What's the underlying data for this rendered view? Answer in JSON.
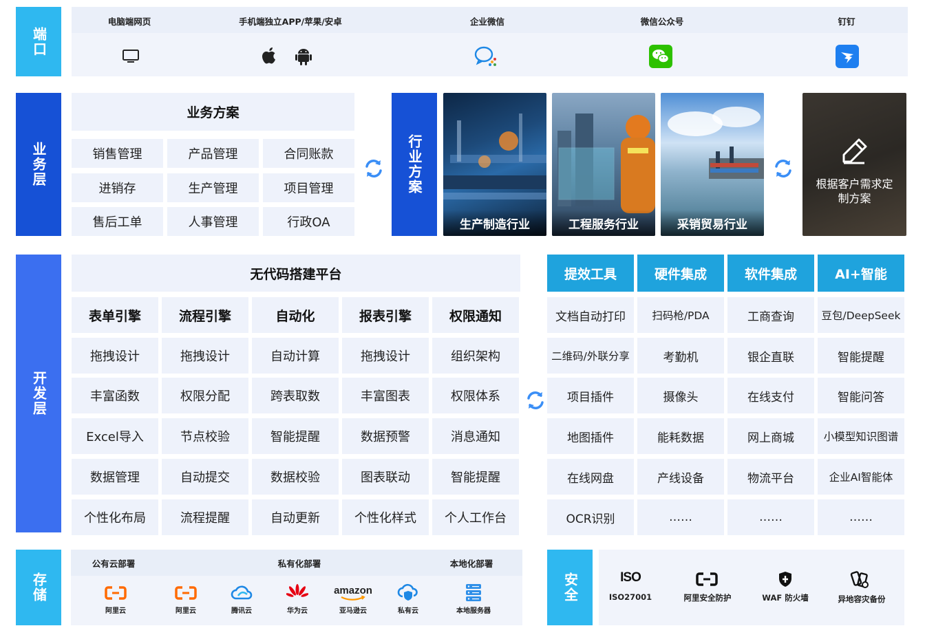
{
  "ports": {
    "side_label": "端口",
    "items": [
      {
        "label": "电脑端网页"
      },
      {
        "label": "手机端独立APP/苹果/安卓"
      },
      {
        "label": "企业微信"
      },
      {
        "label": "微信公众号"
      },
      {
        "label": "钉钉"
      }
    ]
  },
  "business": {
    "side_label": "业务层",
    "title": "业务方案",
    "items": [
      "销售管理",
      "产品管理",
      "合同账款",
      "进销存",
      "生产管理",
      "项目管理",
      "售后工单",
      "人事管理",
      "行政OA"
    ]
  },
  "industry": {
    "side_label": "行业方案",
    "photos": [
      "生产制造行业",
      "工程服务行业",
      "采销贸易行业"
    ],
    "custom": "根据客户需求定制方案"
  },
  "dev": {
    "side_label": "开发层",
    "title": "无代码搭建平台",
    "columns": [
      {
        "head": "表单引擎",
        "items": [
          "拖拽设计",
          "丰富函数",
          "Excel导入",
          "数据管理",
          "个性化布局"
        ]
      },
      {
        "head": "流程引擎",
        "items": [
          "拖拽设计",
          "权限分配",
          "节点校验",
          "自动提交",
          "流程提醒"
        ]
      },
      {
        "head": "自动化",
        "items": [
          "自动计算",
          "跨表取数",
          "智能提醒",
          "数据校验",
          "自动更新"
        ]
      },
      {
        "head": "报表引擎",
        "items": [
          "拖拽设计",
          "丰富图表",
          "数据预警",
          "图表联动",
          "个性化样式"
        ]
      },
      {
        "head": "权限通知",
        "items": [
          "组织架构",
          "权限体系",
          "消息通知",
          "智能提醒",
          "个人工作台"
        ]
      }
    ]
  },
  "tools": {
    "columns": [
      {
        "head": "提效工具",
        "items": [
          "文档自动打印",
          "二维码/外联分享",
          "项目插件",
          "地图插件",
          "在线网盘",
          "OCR识别"
        ]
      },
      {
        "head": "硬件集成",
        "items": [
          "扫码枪/PDA",
          "考勤机",
          "摄像头",
          "能耗数据",
          "产线设备",
          "……"
        ]
      },
      {
        "head": "软件集成",
        "items": [
          "工商查询",
          "银企直联",
          "在线支付",
          "网上商城",
          "物流平台",
          "……"
        ]
      },
      {
        "head": "AI+智能",
        "items": [
          "豆包/DeepSeek",
          "智能提醒",
          "智能问答",
          "小模型知识图谱",
          "企业AI智能体",
          "……"
        ]
      }
    ]
  },
  "storage": {
    "side_label": "存储",
    "groups": [
      "公有云部署",
      "私有化部署",
      "本地化部署"
    ],
    "logos": [
      "阿里云",
      "阿里云",
      "腾讯云",
      "华为云",
      "亚马逊云",
      "私有云",
      "本地服务器"
    ],
    "amazon_word": "amazon"
  },
  "security": {
    "side_label": "安全",
    "iso_mark": "ISO",
    "items": [
      "ISO27001",
      "阿里安全防护",
      "WAF 防火墙",
      "异地容灾备份"
    ]
  },
  "colors": {
    "dark_blue": "#1651d6",
    "mid_blue": "#3b6ff0",
    "light_blue": "#2fb8f0",
    "teal": "#1fa3dd",
    "panel": "#eef2fb"
  }
}
